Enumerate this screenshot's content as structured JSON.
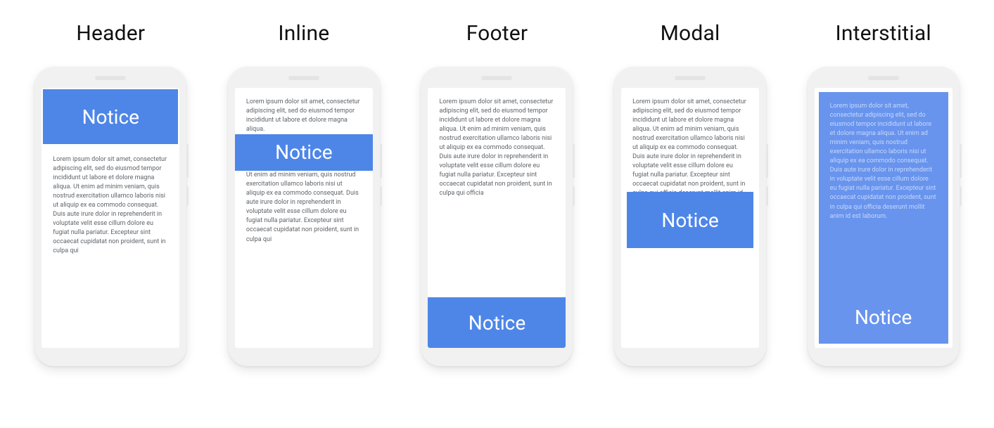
{
  "labels": {
    "header": "Header",
    "inline": "Inline",
    "footer": "Footer",
    "modal": "Modal",
    "interstitial": "Interstitial"
  },
  "notice_label": "Notice",
  "colors": {
    "notice_bg": "#4e86e8",
    "overlay_bg": "#6894ee",
    "text_muted": "#5f6368"
  },
  "lorem": {
    "p1": "Lorem ipsum dolor sit amet, consectetur adipiscing elit, sed do eiusmod tempor incididunt ut labore et dolore magna aliqua. Ut enim ad minim veniam, quis nostrud exercitation ullamco laboris nisi ut aliquip ex ea commodo consequat. Duis aute irure dolor in reprehenderit in voluptate velit esse cillum dolore eu fugiat nulla pariatur. Excepteur sint occaecat cupidatat non proident, sunt in culpa qui",
    "p_short": "Lorem ipsum dolor sit amet, consectetur adipiscing elit, sed do eiusmod tempor incididunt ut labore et dolore magna aliqua.",
    "p_mid": "Ut enim ad minim veniam, quis nostrud exercitation ullamco laboris nisi ut aliquip ex ea commodo consequat. Duis aute irure dolor in reprehenderit in voluptate velit esse cillum dolore eu fugiat nulla pariatur. Excepteur sint occaecat cupidatat non proident, sunt in culpa qui",
    "p_footer": "Lorem ipsum dolor sit amet, consectetur adipiscing elit, sed do eiusmod tempor incididunt ut labore et dolore magna aliqua. Ut enim ad minim veniam, quis nostrud exercitation ullamco laboris nisi ut aliquip ex ea commodo consequat. Duis aute irure dolor in reprehenderit in voluptate velit esse cillum dolore eu fugiat nulla pariatur. Excepteur sint occaecat cupidatat non proident, sunt in culpa qui officia",
    "p_modal": "Lorem ipsum dolor sit amet, consectetur adipiscing elit, sed do eiusmod tempor incididunt ut labore et dolore magna aliqua. Ut enim ad minim veniam, quis nostrud exercitation ullamco laboris nisi ut aliquip ex ea commodo consequat. Duis aute irure dolor in reprehenderit in voluptate velit esse cillum dolore eu fugiat nulla pariatur. Excepteur sint occaecat cupidatat non proident, sunt in culpa qui officia deserunt mollit anim id est laborum.",
    "p_interstitial": "Lorem ipsum dolor sit amet, consectetur adipiscing elit, sed do eiusmod tempor incididunt ut labore et dolore magna aliqua. Ut enim ad minim veniam, quis nostrud exercitation ullamco laboris nisi ut aliquip ex ea commodo consequat. Duis aute irure dolor in reprehenderit in voluptate velit esse cillum dolore eu fugiat nulla pariatur. Excepteur sint occaecat cupidatat non proident, sunt in culpa qui officia deserunt mollit anim id est laborum."
  }
}
